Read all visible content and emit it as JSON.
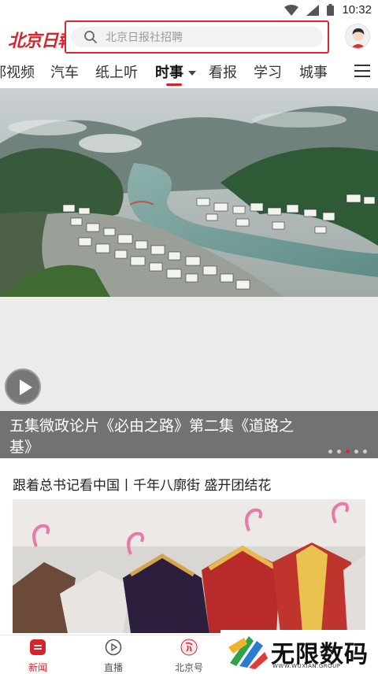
{
  "status_bar": {
    "time": "10:32"
  },
  "header": {
    "logo": "北京日報",
    "search": {
      "placeholder": "北京日报社招聘"
    }
  },
  "nav": {
    "tabs": [
      {
        "label": "都视频",
        "active": false
      },
      {
        "label": "汽车",
        "active": false
      },
      {
        "label": "纸上听",
        "active": false
      },
      {
        "label": "时事",
        "active": true
      },
      {
        "label": "看报",
        "active": false
      },
      {
        "label": "学习",
        "active": false
      },
      {
        "label": "城事",
        "active": false
      }
    ]
  },
  "hero": {
    "caption": "五集微政论片《必由之路》第二集《道路之基》",
    "carousel": {
      "count": 5,
      "active_index": 2
    }
  },
  "article": {
    "title": "跟着总书记看中国丨千年八廓街 盛开团结花"
  },
  "bottom_nav": {
    "items": [
      {
        "label": "新闻",
        "icon": "news-icon",
        "active": true
      },
      {
        "label": "直播",
        "icon": "play-circle-icon",
        "active": false
      },
      {
        "label": "北京号",
        "icon": "beijing-hao-icon",
        "active": false
      }
    ]
  },
  "watermark": {
    "text": "无限数码",
    "sub": "WWW.WUXIAN.GROUP"
  },
  "colors": {
    "accent": "#d8232a",
    "search_border": "#e02626"
  }
}
